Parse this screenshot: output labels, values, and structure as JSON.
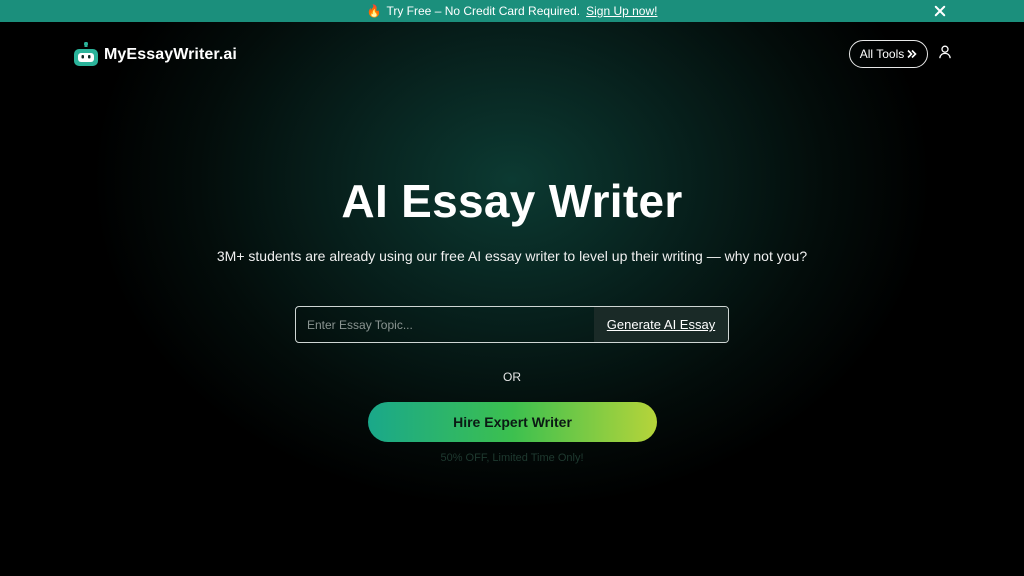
{
  "promo": {
    "flame_icon": "fire-icon",
    "text": "Try Free – No Credit Card Required.",
    "link": "Sign Up now!"
  },
  "header": {
    "logo_text": "MyEssayWriter.ai",
    "all_tools_label": "All Tools",
    "all_tools_icon": "double-chevron-right-icon",
    "user_icon": "user-icon"
  },
  "hero": {
    "title": "AI Essay Writer",
    "subtitle": "3M+ students are already using our free AI essay writer to level up their writing — why not you?",
    "topic_placeholder": "Enter Essay Topic...",
    "topic_value": "",
    "generate_label": "Generate AI Essay",
    "or_label": "OR",
    "hire_label": "Hire Expert Writer",
    "offer_text": "50% OFF, Limited Time Only!"
  },
  "colors": {
    "promo_bar": "#1b8f7c",
    "background": "#000000",
    "hire_gradient": [
      "#1aa88a",
      "#3cc04f",
      "#b6d43a"
    ]
  }
}
